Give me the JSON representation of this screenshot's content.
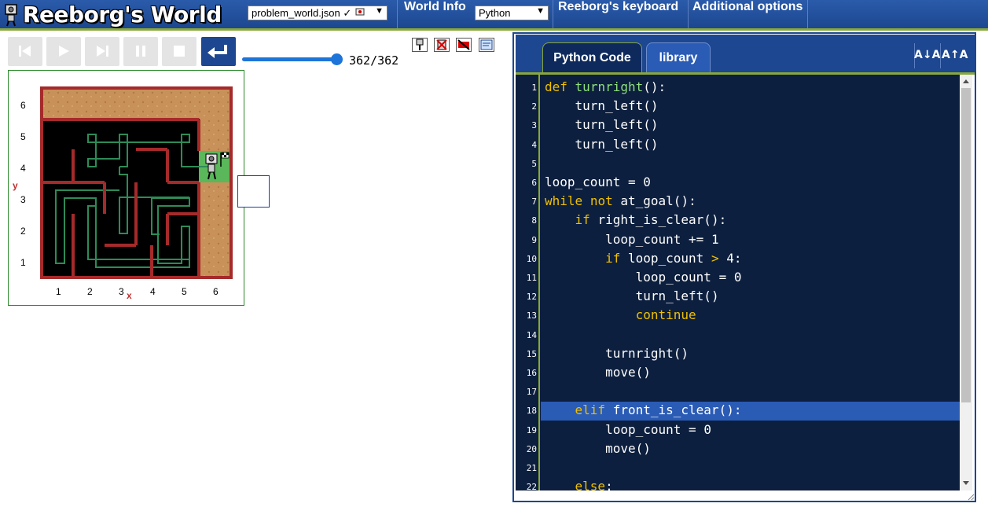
{
  "header": {
    "app_title": "Reeborg's World",
    "world_select": "problem_world.json ✓",
    "world_info": "World Info",
    "language_select": "Python",
    "keyboard": "Reeborg's keyboard",
    "additional_options": "Additional options"
  },
  "controls": {
    "step_current": 362,
    "step_total": 362,
    "step_display": "362/362",
    "slider_fraction": 1.0
  },
  "world": {
    "x_axis_label": "x",
    "y_axis_label": "y",
    "x_ticks": [
      "1",
      "2",
      "3",
      "4",
      "5",
      "6"
    ],
    "y_ticks": [
      "6",
      "5",
      "4",
      "3",
      "2",
      "1"
    ],
    "colors": {
      "wall": "#a52a2a",
      "path": "#2e8b57",
      "floor": "#000000",
      "sand": "#c8915a",
      "goal": "#5ab75a"
    }
  },
  "editor": {
    "tabs": [
      "Python Code",
      "library"
    ],
    "active_tab": "Python Code",
    "font_decrease": "A↓A",
    "font_increase": "A↑A",
    "current_line": 18,
    "lines": [
      {
        "n": "1",
        "text": "def turnright():"
      },
      {
        "n": "2",
        "text": "    turn_left()"
      },
      {
        "n": "3",
        "text": "    turn_left()"
      },
      {
        "n": "4",
        "text": "    turn_left()"
      },
      {
        "n": "5",
        "text": ""
      },
      {
        "n": "6",
        "text": "loop_count = 0"
      },
      {
        "n": "7",
        "text": "while not at_goal():"
      },
      {
        "n": "8",
        "text": "    if right_is_clear():"
      },
      {
        "n": "9",
        "text": "        loop_count += 1"
      },
      {
        "n": "10",
        "text": "        if loop_count > 4:"
      },
      {
        "n": "11",
        "text": "            loop_count = 0"
      },
      {
        "n": "12",
        "text": "            turn_left()"
      },
      {
        "n": "13",
        "text": "            continue"
      },
      {
        "n": "14",
        "text": ""
      },
      {
        "n": "15",
        "text": "        turnright()"
      },
      {
        "n": "16",
        "text": "        move()"
      },
      {
        "n": "17",
        "text": ""
      },
      {
        "n": "18",
        "text": "    elif front_is_clear():"
      },
      {
        "n": "19",
        "text": "        loop_count = 0"
      },
      {
        "n": "20",
        "text": "        move()"
      },
      {
        "n": "21",
        "text": ""
      },
      {
        "n": "22",
        "text": "    else:"
      }
    ]
  }
}
